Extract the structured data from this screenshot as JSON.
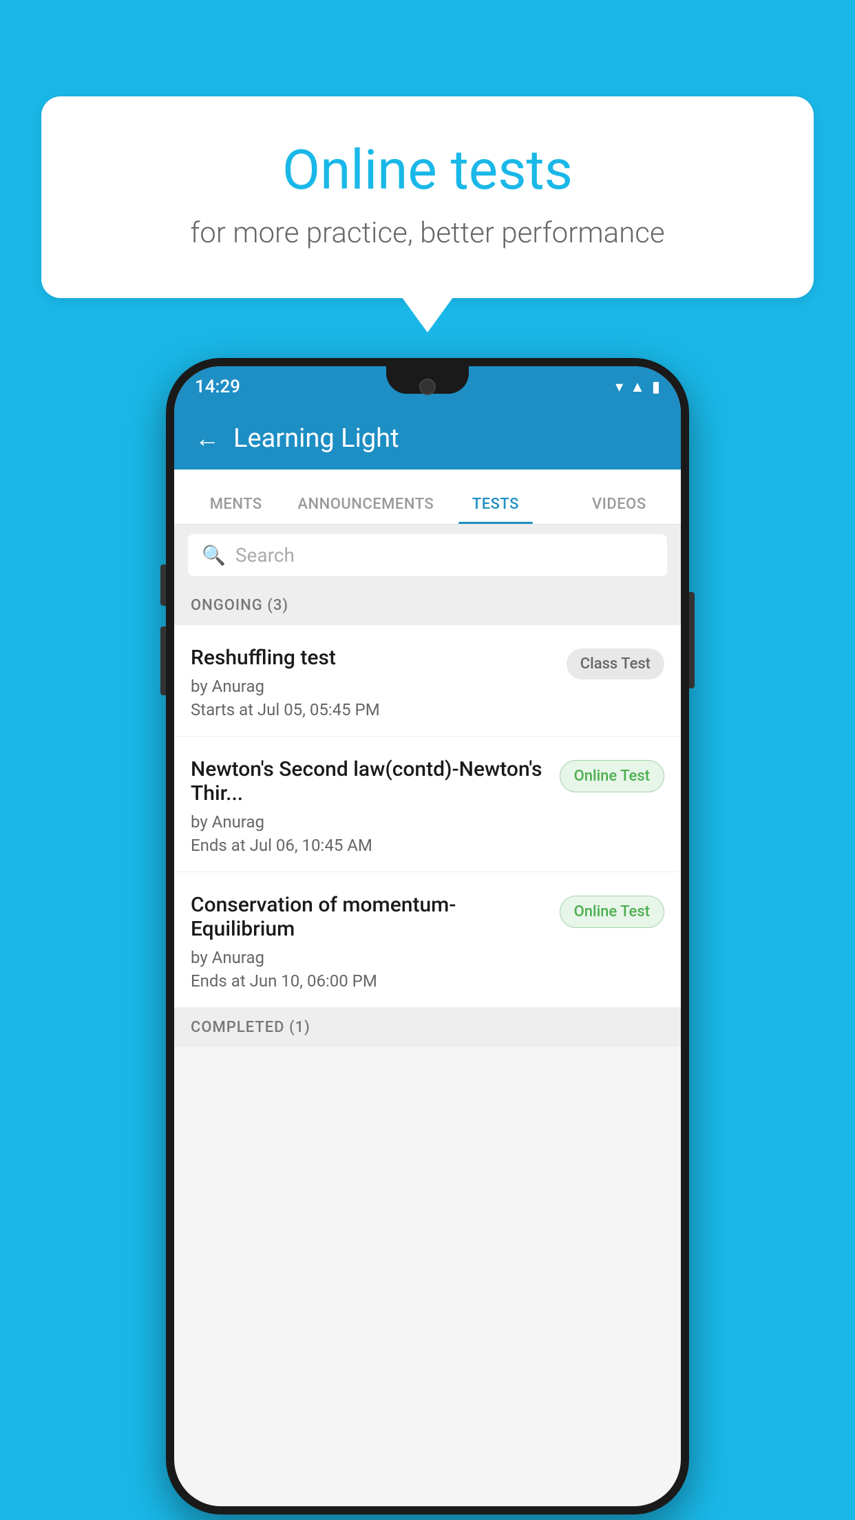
{
  "background": {
    "color": "#1ab8e8"
  },
  "speech_bubble": {
    "title": "Online tests",
    "subtitle": "for more practice, better performance"
  },
  "phone": {
    "status_bar": {
      "time": "14:29",
      "icons": [
        "wifi",
        "signal",
        "battery"
      ]
    },
    "header": {
      "back_label": "←",
      "title": "Learning Light"
    },
    "tabs": [
      {
        "label": "MENTS",
        "active": false
      },
      {
        "label": "ANNOUNCEMENTS",
        "active": false
      },
      {
        "label": "TESTS",
        "active": true
      },
      {
        "label": "VIDEOS",
        "active": false
      }
    ],
    "search": {
      "placeholder": "Search"
    },
    "ongoing_section": {
      "label": "ONGOING (3)"
    },
    "tests": [
      {
        "name": "Reshuffling test",
        "author": "by Anurag",
        "date": "Starts at  Jul 05, 05:45 PM",
        "badge": "Class Test",
        "badge_type": "class"
      },
      {
        "name": "Newton's Second law(contd)-Newton's Thir...",
        "author": "by Anurag",
        "date": "Ends at  Jul 06, 10:45 AM",
        "badge": "Online Test",
        "badge_type": "online"
      },
      {
        "name": "Conservation of momentum-Equilibrium",
        "author": "by Anurag",
        "date": "Ends at  Jun 10, 06:00 PM",
        "badge": "Online Test",
        "badge_type": "online"
      }
    ],
    "completed_section": {
      "label": "COMPLETED (1)"
    }
  }
}
